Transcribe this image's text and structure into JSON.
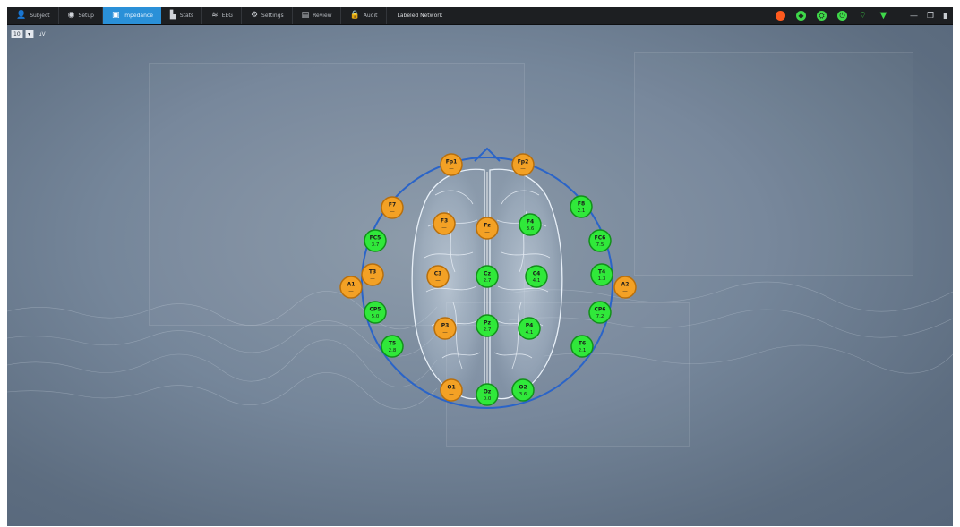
{
  "toolbar": {
    "tabs": [
      {
        "id": "subject",
        "label": "Subject",
        "icon": "person-icon",
        "glyph": "👤",
        "active": false
      },
      {
        "id": "setup",
        "label": "Setup",
        "icon": "globe-icon",
        "glyph": "◉",
        "active": false
      },
      {
        "id": "impedance",
        "label": "Impedance",
        "icon": "monitor-icon",
        "glyph": "▣",
        "active": true
      },
      {
        "id": "stats",
        "label": "Stats",
        "icon": "chart-icon",
        "glyph": "▙",
        "active": false
      },
      {
        "id": "eeg",
        "label": "EEG",
        "icon": "wave-icon",
        "glyph": "≋",
        "active": false
      },
      {
        "id": "settings",
        "label": "Settings",
        "icon": "gear-icon",
        "glyph": "⚙",
        "active": false
      },
      {
        "id": "review",
        "label": "Review",
        "icon": "screen-icon",
        "glyph": "▤",
        "active": false
      },
      {
        "id": "audit",
        "label": "Audit",
        "icon": "lock-icon",
        "glyph": "🔒",
        "active": false
      }
    ],
    "title_label": "Labeled Network"
  },
  "status_icons": [
    {
      "name": "record-status-icon",
      "color": "#ff5a1e",
      "glyph": ""
    },
    {
      "name": "device-status-icon",
      "color": "#3fd84a",
      "glyph": "◆"
    },
    {
      "name": "network-status-icon",
      "color": "#3fd84a",
      "glyph": "⛭"
    },
    {
      "name": "power-status-icon",
      "color": "#3fd84a",
      "glyph": "⏻"
    },
    {
      "name": "wifi-status-icon",
      "color": "#3fd84a",
      "glyph": "⌔"
    },
    {
      "name": "signal-status-icon",
      "color": "#3fd84a",
      "glyph": "▼"
    }
  ],
  "window_controls": {
    "minimize": "—",
    "restore": "❐",
    "close": "▮"
  },
  "mini_toolbar": {
    "btn1": "10",
    "btn2": "▾",
    "label": "μV"
  },
  "colors": {
    "good": "#30e83a",
    "good_stroke": "#12901a",
    "poor": "#f3a125",
    "poor_stroke": "#b86f0c",
    "head_outline": "#2a64c8",
    "active_tab": "#2a90d8"
  },
  "electrodes": [
    {
      "label": "Fp1",
      "value": "—",
      "status": "poor"
    },
    {
      "label": "Fp2",
      "value": "—",
      "status": "poor"
    },
    {
      "label": "F7",
      "value": "—",
      "status": "poor"
    },
    {
      "label": "F3",
      "value": "—",
      "status": "poor"
    },
    {
      "label": "Fz",
      "value": "—",
      "status": "poor"
    },
    {
      "label": "F4",
      "value": "3.6",
      "status": "good"
    },
    {
      "label": "F8",
      "value": "2.1",
      "status": "good"
    },
    {
      "label": "FC5",
      "value": "3.7",
      "status": "good"
    },
    {
      "label": "FC6",
      "value": "7.5",
      "status": "good"
    },
    {
      "label": "T3",
      "value": "—",
      "status": "poor"
    },
    {
      "label": "A1",
      "value": "—",
      "status": "poor"
    },
    {
      "label": "C3",
      "value": "—",
      "status": "poor"
    },
    {
      "label": "Cz",
      "value": "2.7",
      "status": "good"
    },
    {
      "label": "C4",
      "value": "4.1",
      "status": "good"
    },
    {
      "label": "T4",
      "value": "1.3",
      "status": "good"
    },
    {
      "label": "A2",
      "value": "—",
      "status": "poor"
    },
    {
      "label": "CP5",
      "value": "5.0",
      "status": "good"
    },
    {
      "label": "CP6",
      "value": "7.2",
      "status": "good"
    },
    {
      "label": "P3",
      "value": "—",
      "status": "poor"
    },
    {
      "label": "Pz",
      "value": "2.7",
      "status": "good"
    },
    {
      "label": "P4",
      "value": "4.1",
      "status": "good"
    },
    {
      "label": "T5",
      "value": "2.8",
      "status": "good"
    },
    {
      "label": "T6",
      "value": "2.1",
      "status": "good"
    },
    {
      "label": "O1",
      "value": "—",
      "status": "poor"
    },
    {
      "label": "Oz",
      "value": "0.0",
      "status": "good"
    },
    {
      "label": "O2",
      "value": "3.6",
      "status": "good"
    }
  ]
}
